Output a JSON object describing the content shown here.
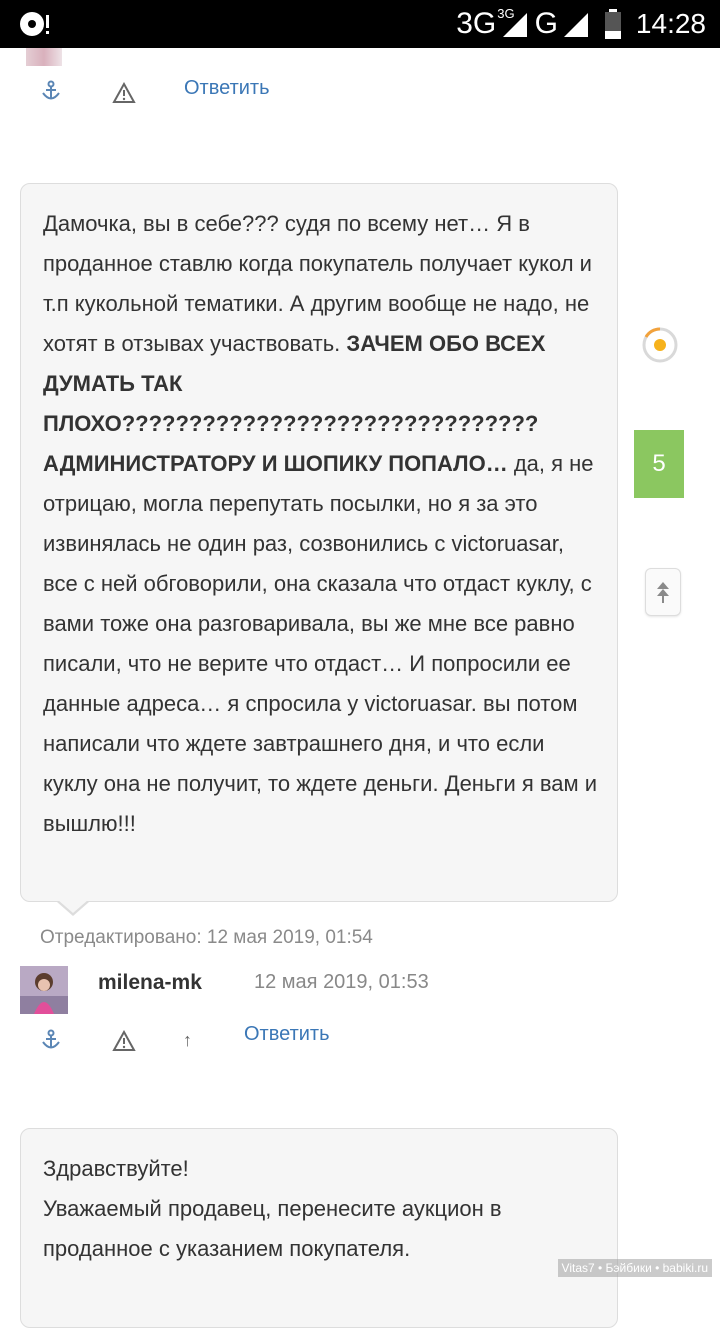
{
  "status_bar": {
    "network_primary": "3G",
    "network_sup": "3G",
    "network_secondary": "G",
    "time": "14:28"
  },
  "actions_top": {
    "reply_label": "Ответить"
  },
  "comment": {
    "text_intro": "Дамочка, вы в себе??? судя по всему нет… Я в проданное ставлю когда покупатель получает кукол и т.п кукольной тематики. А другим вообще не надо, не хотят в отзывах участвовать. ",
    "text_bold": "ЗАЧЕМ ОБО ВСЕХ ДУМАТЬ ТАК ПЛОХО??????????????????????????????? АДМИНИСТРАТОРУ И ШОПИКУ ПОПАЛО…",
    "text_rest": " да, я не отрицаю, могла перепутать посылки, но я за это извинялась не один раз, созвонились с victoruasar, все с ней обговорили, она сказала что отдаст куклу, с вами тоже она разговаривала, вы же мне все равно писали, что не верите что отдаст… И попросили ее данные адреса… я спросила у victoruasar. вы потом написали что ждете завтрашнего дня, и что если куклу она не получит, то ждете деньги. Деньги я вам и вышлю!!!",
    "edited": "Отредактировано: 12 мая 2019, 01:54",
    "author": "milena-mk",
    "date": "12 мая 2019, 01:53",
    "reply_label": "Ответить",
    "up_arrow": "↑"
  },
  "next_comment": {
    "line1": "Здравствуйте!",
    "line2": "Уважаемый продавец, перенесите аукцион в проданное с указанием покупателя."
  },
  "sidebar": {
    "score": "5"
  },
  "watermark": "Vitas7 • Бэйбики • babiki.ru",
  "colors": {
    "link": "#3b77b6",
    "badge": "#8bc760",
    "bubble_bg": "#f6f6f6"
  }
}
